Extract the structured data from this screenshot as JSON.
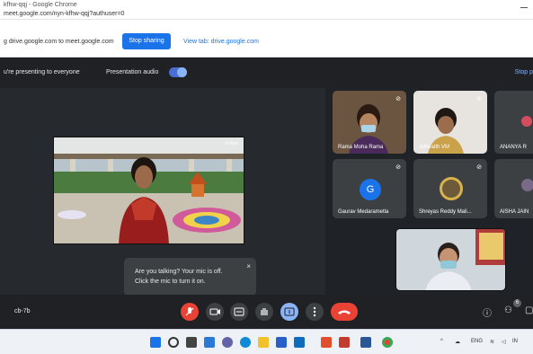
{
  "browser": {
    "title": "kfhw-qqj - Google Chrome",
    "url": "meet.google.com/nyn-kfhw-qqj?authuser=0"
  },
  "share_bar": {
    "message": "g drive.google.com to meet.google.com",
    "stop_label": "Stop sharing",
    "view_tab_label": "View tab: drive.google.com"
  },
  "present_bar": {
    "status": "u're presenting to everyone",
    "audio_label": "Presentation audio",
    "stop_label": "Stop p"
  },
  "participants": [
    {
      "name": "Rama Moha Rama"
    },
    {
      "name": "Adhvaith VM"
    },
    {
      "name": "ANANYA R"
    },
    {
      "name": "Gaurav Medarametla",
      "initial": "G"
    },
    {
      "name": "Shreyas Reddy Mali..."
    },
    {
      "name": "AISHA JAIN"
    }
  ],
  "slide_caption": "Kolam",
  "tooltip": {
    "line1": "Are you talking? Your mic is off.",
    "line2": "Click the mic to turn it on.",
    "close": "×"
  },
  "controls": {
    "meeting_code": "cb-7b",
    "mic_icon": "✎",
    "participants_badge": "6",
    "end_icon": "☎"
  },
  "taskbar": {
    "lang": "ENG",
    "tray": "IN"
  },
  "colors": {
    "stop_button": "#1a73e8",
    "end_call": "#ea4335",
    "meet_bg": "#202124"
  }
}
